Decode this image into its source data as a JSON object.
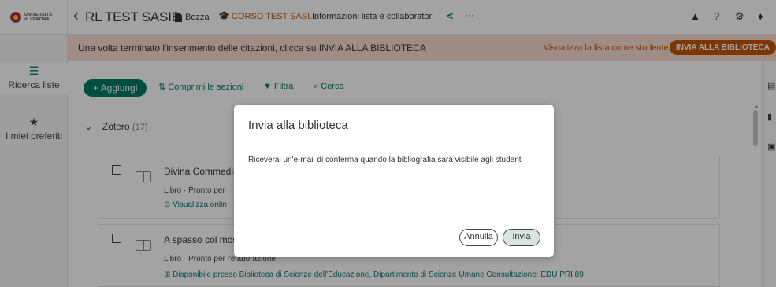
{
  "header": {
    "logo_text_1": "UNIVERSITÀ",
    "logo_text_2": "di VERONA",
    "back_icon": "‹",
    "title": "RL TEST SASIB",
    "status": "Bozza",
    "course": "CORSO TEST SASI...",
    "info_link": "Informazioni lista e collaboratori",
    "share_icon": "share-icon",
    "more_label": "···"
  },
  "sidebar": {
    "items": [
      {
        "icon": "☰",
        "label": "Ricerca liste"
      },
      {
        "icon": "★",
        "label": "I miei preferiti"
      }
    ]
  },
  "banner": {
    "text": "Una volta terminato l'inserimento delle citazioni, clicca su INVIA ALLA BIBLIOTECA",
    "student_view_link": "Visualizza la lista come studente",
    "send_button": "INVIA ALLA BIBLIOTECA"
  },
  "toolbar": {
    "add_label": "+ Aggiungi",
    "collapse_label": "Comprimi le sezioni",
    "filter_label": "Filtra",
    "search_label": "Cerca"
  },
  "section": {
    "name": "Zotero",
    "count": "(17)"
  },
  "items": [
    {
      "title": "Divina Commedia",
      "meta": "Libro · Pronto per",
      "link": "Visualizza onlin"
    },
    {
      "title": "A spasso col mos",
      "meta": "Libro · Pronto per l'elaborazione",
      "link": "Disponibile presso Biblioteca di Scienze dell'Educazione, Dipartimento di Scienze Umane Consultazione: EDU PRI 89"
    }
  ],
  "modal": {
    "title": "Invia alla biblioteca",
    "body": "Riceverai un'e-mail di conferma quando la bibliografia sarà visibile agli studenti",
    "cancel": "Annulla",
    "confirm": "Invia"
  },
  "colors": {
    "accent": "#00796b",
    "brand_orange": "#c45500",
    "banner_bg": "#f7ddd1"
  }
}
